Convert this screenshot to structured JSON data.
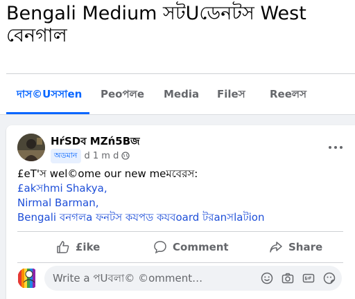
{
  "group": {
    "title": "Bengali Medium সটUডেনটস West বেনগাল"
  },
  "tabs": [
    {
      "label": "দাস©Uসসাen"
    },
    {
      "label": "Peoপলe"
    },
    {
      "label": "Media"
    },
    {
      "label": "Fileস"
    },
    {
      "label": "Reeলস"
    }
  ],
  "post": {
    "author": "HŕSDব MZń5Bজ",
    "badge": "অডমান",
    "time": "d 1 m d",
    "body": {
      "intro": "£eT'স wel©ome our new meমবেরস:",
      "mentions": [
        "£akসhmi Shakya,",
        "Nirmal Barman,",
        "Bengali বনগলa ফনটস কযপড কযবoard টরanসlaটion"
      ]
    },
    "actions": {
      "like": "£ike",
      "comment": "Comment",
      "share": "Share"
    }
  },
  "comment_input": {
    "placeholder": "Write a পUবলা© ©omment…"
  },
  "colors": {
    "accent": "#0866ff",
    "link": "#1d4ed8",
    "muted": "#65676b",
    "background": "#f0f2f5"
  }
}
